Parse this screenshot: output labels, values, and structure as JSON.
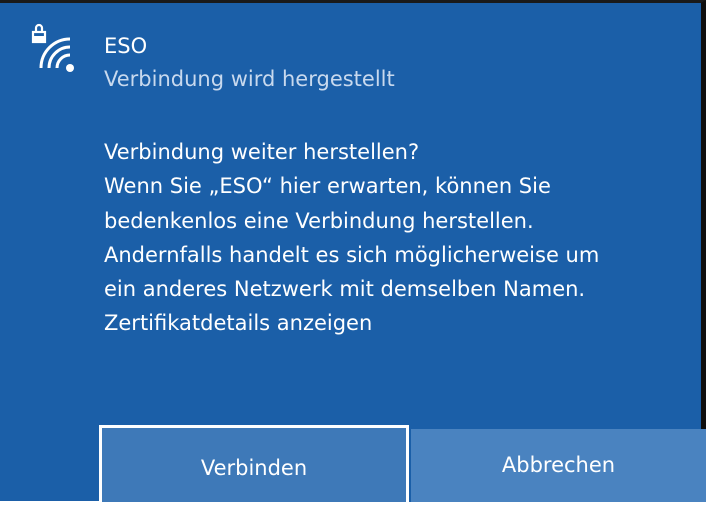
{
  "network": {
    "name": "ESO",
    "status": "Verbindung wird hergestellt"
  },
  "message": {
    "lines": [
      "Verbindung weiter herstellen?",
      "Wenn Sie „ESO“ hier erwarten, können Sie",
      "bedenkenlos eine Verbindung herstellen.",
      "Andernfalls handelt es sich möglicherweise um",
      "ein anderes Netzwerk mit demselben Namen."
    ],
    "cert_link": "Zertifikatdetails anzeigen"
  },
  "buttons": {
    "connect": "Verbinden",
    "cancel": "Abbrechen"
  },
  "colors": {
    "background": "#1b5fa8",
    "button": "#4a83c0",
    "text_secondary": "#c8d9ee"
  },
  "icons": {
    "network": "wifi-secured-icon"
  }
}
